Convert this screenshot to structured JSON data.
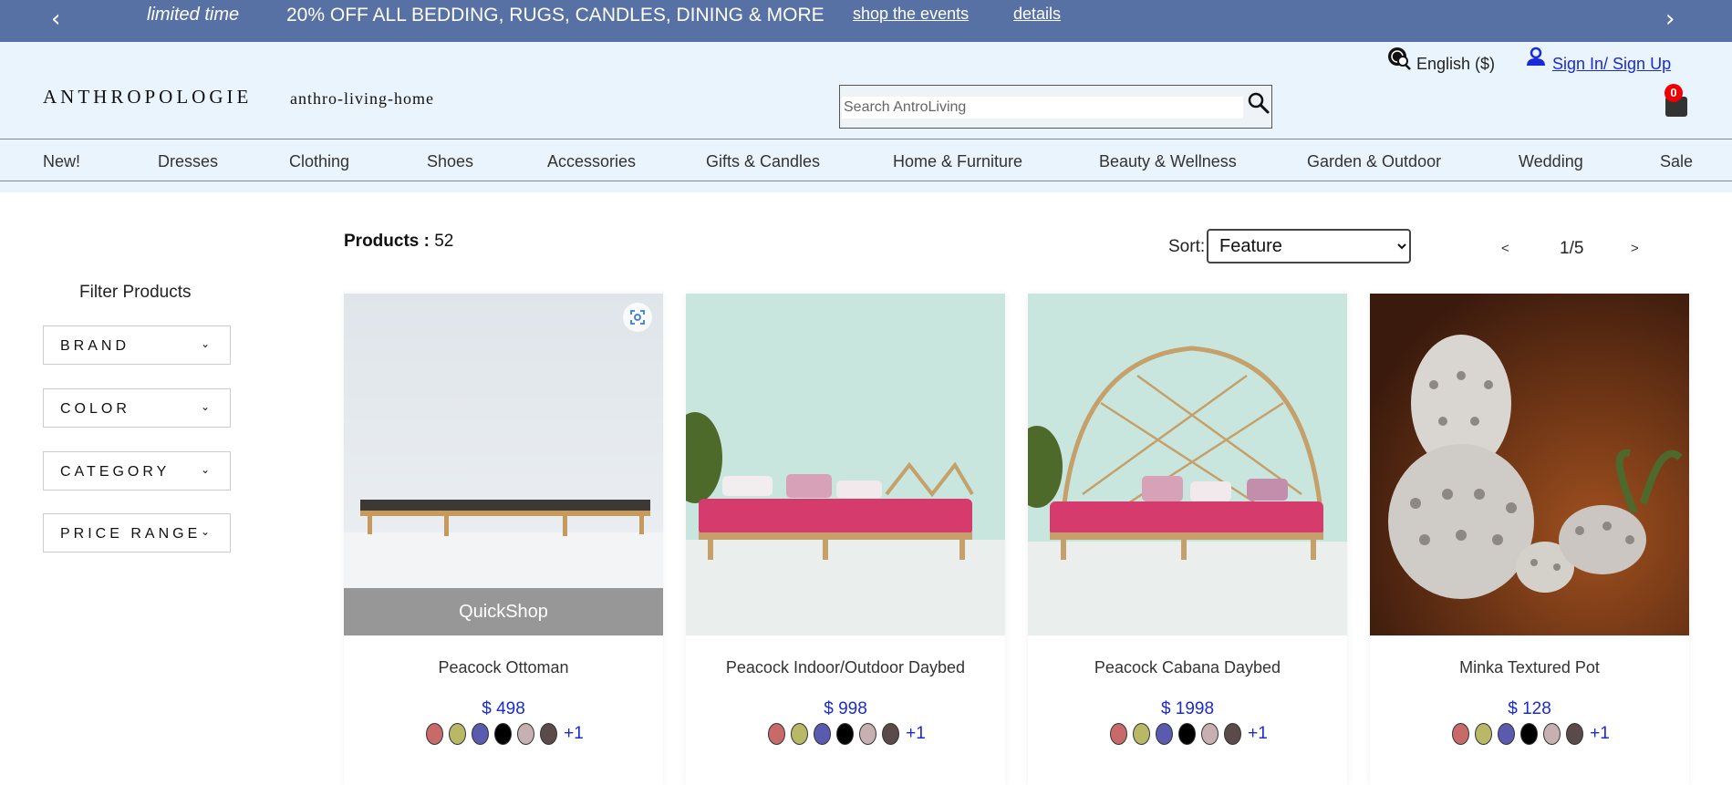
{
  "promo": {
    "limited": "limited time",
    "headline": "20% OFF ALL BEDDING, RUGS, CANDLES, DINING & MORE",
    "events_link": "shop the events",
    "details_link": "details",
    "left_arrow": "‹",
    "right_arrow": "›",
    "bg_color": "#5871a4"
  },
  "header": {
    "logo_main": "ANTHROPOLOGIE",
    "logo_sub": "anthro-living-home",
    "search_placeholder": "Search AntroLiving",
    "language": "English ($)",
    "signin": "Sign In/ Sign Up",
    "cart_count": "0"
  },
  "nav": [
    "New!",
    "Dresses",
    "Clothing",
    "Shoes",
    "Accessories",
    "Gifts & Candles",
    "Home & Furniture",
    "Beauty & Wellness",
    "Garden & Outdoor",
    "Wedding",
    "Sale"
  ],
  "sidebar": {
    "title": "Filter Products",
    "filters": [
      "BRAND",
      "COLOR",
      "CATEGORY",
      "PRICE RANGE"
    ]
  },
  "toolbar": {
    "products_label": "Products :",
    "products_count": "52",
    "sort_label": "Sort:",
    "sort_value": "Feature",
    "prev": "<",
    "page": "1/5",
    "next": ">"
  },
  "products": [
    {
      "name": "Peacock Ottoman",
      "price": "$ 498",
      "more": "+1",
      "quickshop": "QuickShop"
    },
    {
      "name": "Peacock Indoor/Outdoor Daybed",
      "price": "$ 998",
      "more": "+1"
    },
    {
      "name": "Peacock Cabana Daybed",
      "price": "$ 1998",
      "more": "+1"
    },
    {
      "name": "Minka Textured Pot",
      "price": "$ 128",
      "more": "+1"
    }
  ],
  "swatch_colors": [
    "#c96a6a",
    "#b8b866",
    "#5a5aae",
    "#000000",
    "#c7b0b2",
    "#5a4a4a"
  ],
  "accent_color": "#1a2ad8"
}
